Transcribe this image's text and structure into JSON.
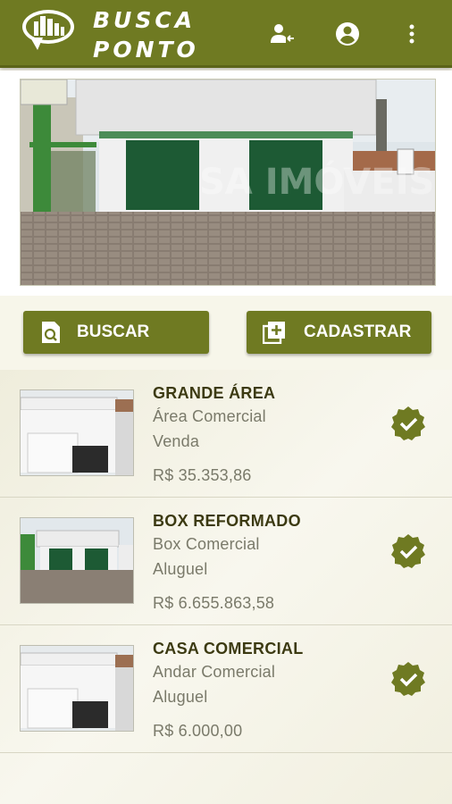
{
  "app": {
    "brand_line1": "BUSCA",
    "brand_line2": "PONTO",
    "accent": "#6f7a22",
    "icons": [
      "logo-icon",
      "person-arrow-icon",
      "account-circle-icon",
      "more-vert-icon"
    ]
  },
  "hero": {
    "image": "storefront-photo",
    "watermark": "SA IMÓVEIS"
  },
  "actions": {
    "search_label": "BUSCAR",
    "register_label": "CADASTRAR"
  },
  "listings": [
    {
      "title": "GRANDE ÁREA",
      "type": "Área Comercial",
      "deal": "Venda",
      "price": "R$ 35.353,86",
      "verified": true
    },
    {
      "title": "BOX REFORMADO",
      "type": "Box Comercial",
      "deal": "Aluguel",
      "price": "R$ 6.655.863,58",
      "verified": true
    },
    {
      "title": "CASA COMERCIAL",
      "type": "Andar Comercial",
      "deal": "Aluguel",
      "price": "R$ 6.000,00",
      "verified": true
    }
  ]
}
